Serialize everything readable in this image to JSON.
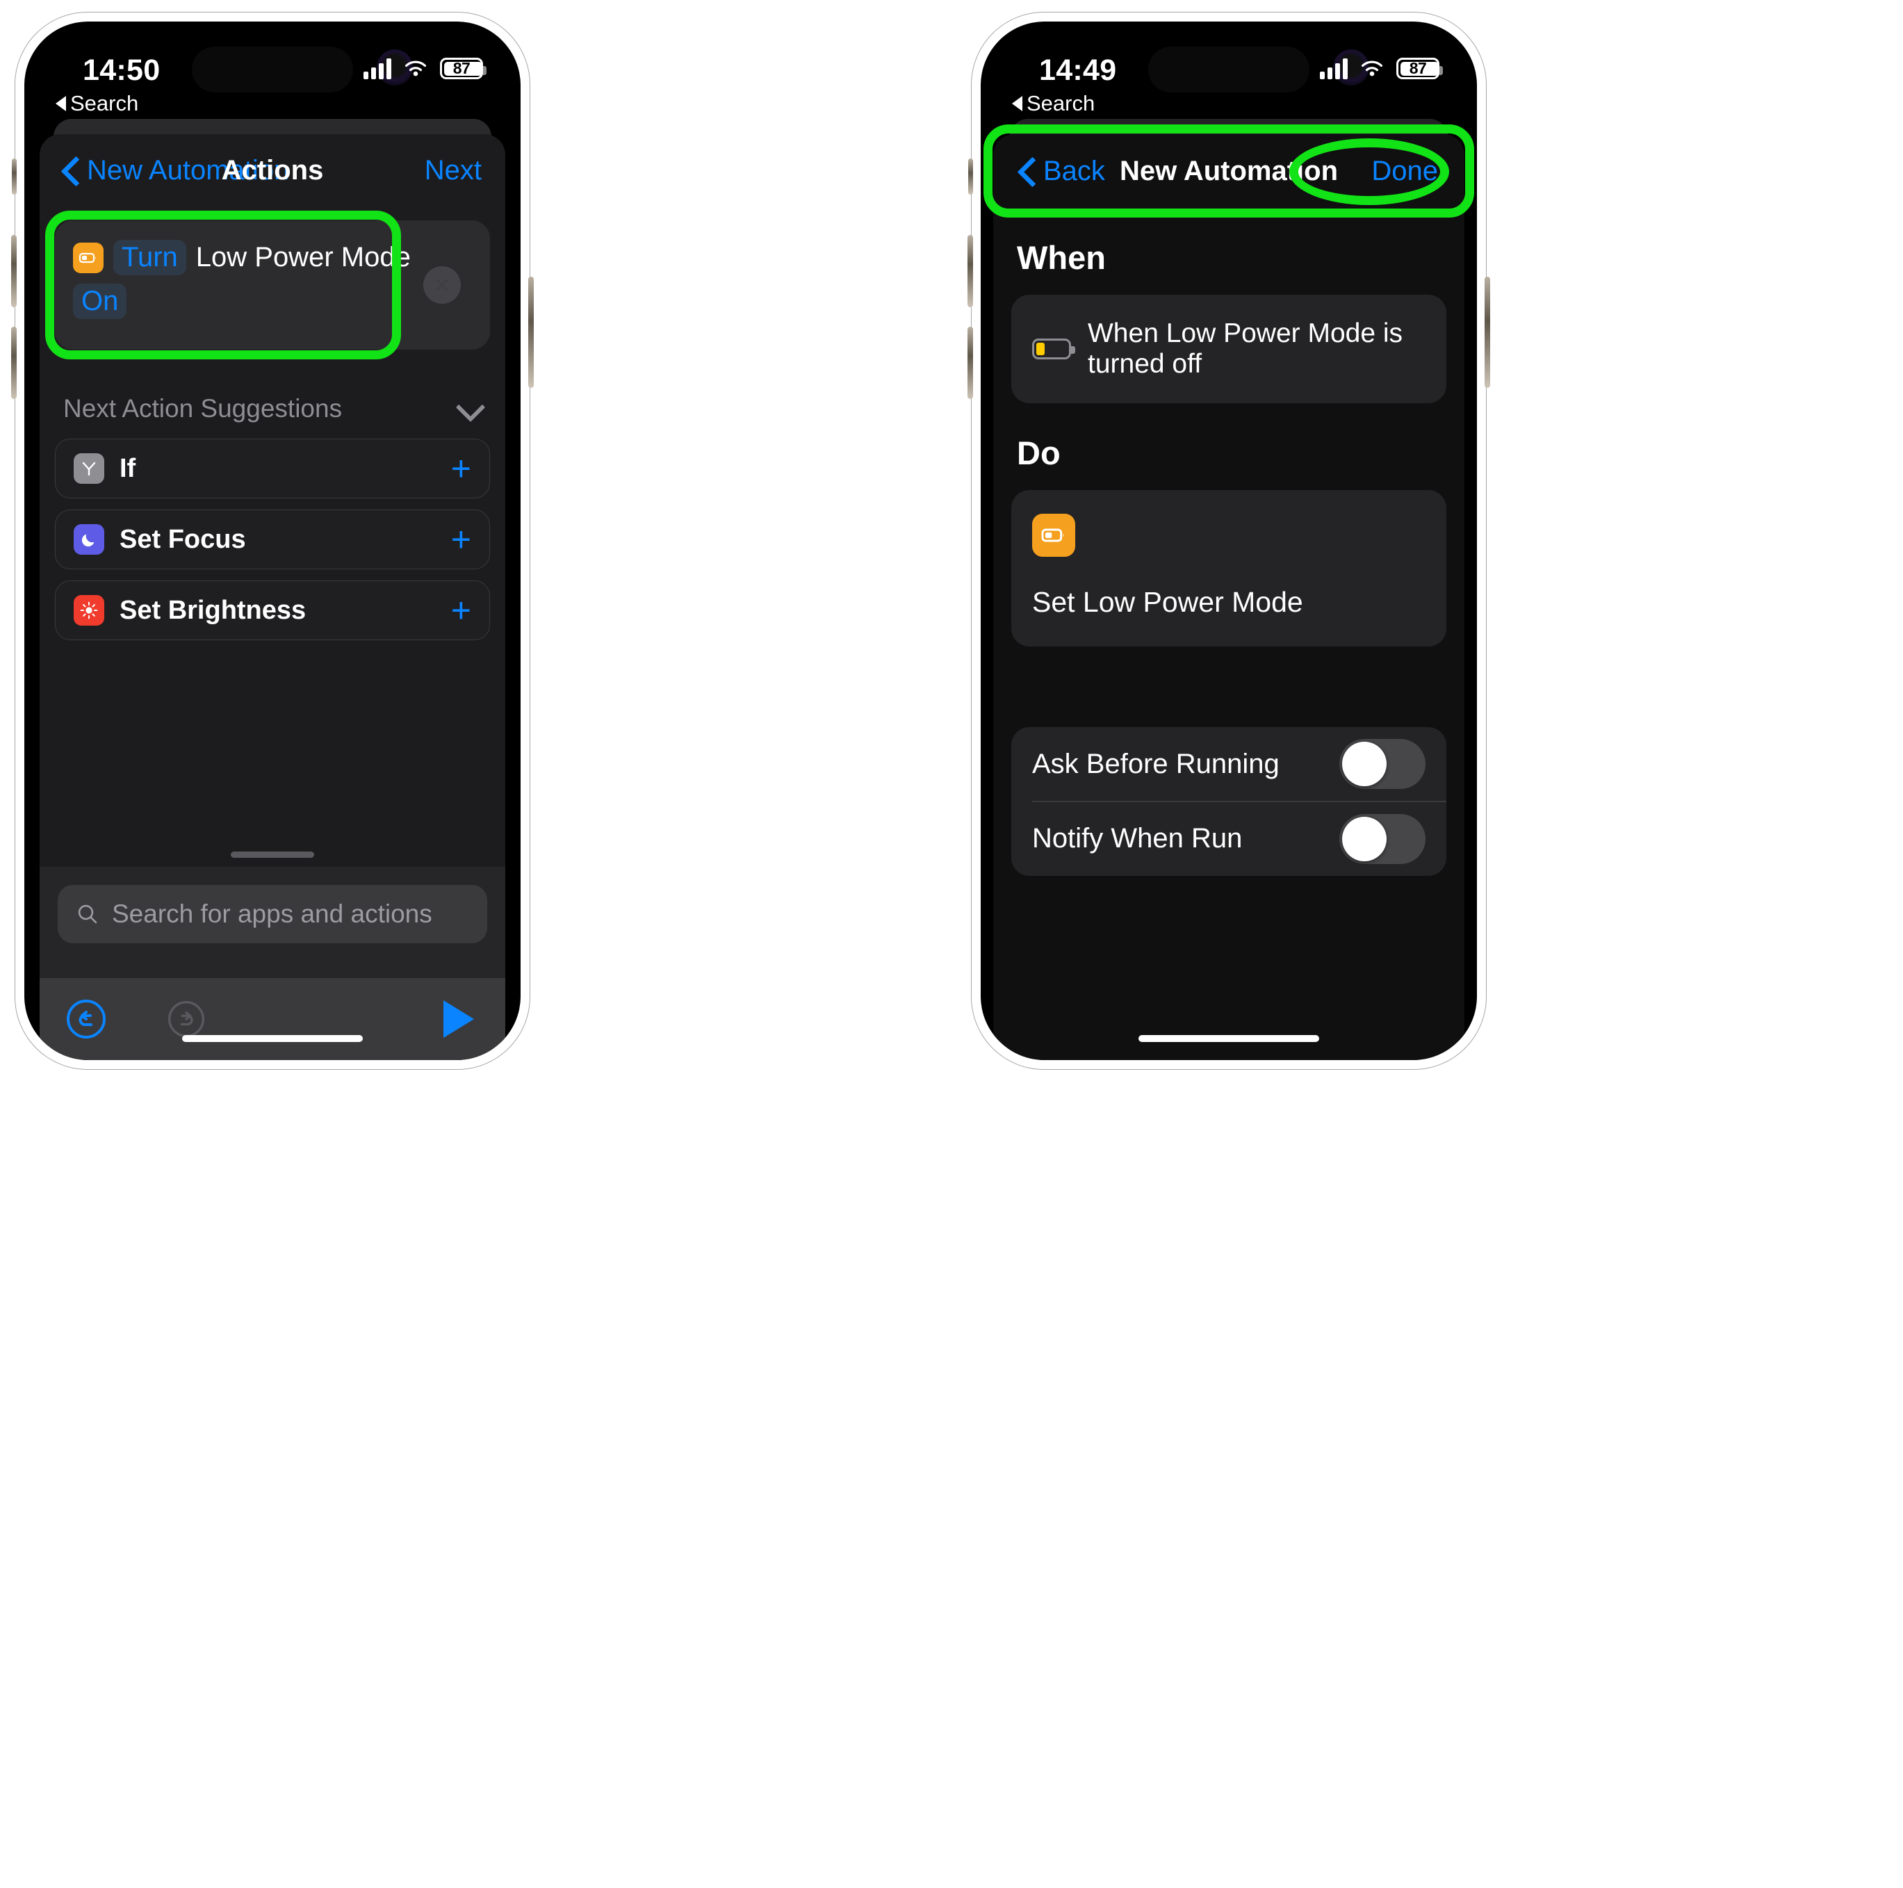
{
  "left_phone": {
    "status_bar": {
      "time": "14:50",
      "back_label": "Search",
      "battery_percent": "87",
      "icons": [
        "cellular-signal-icon",
        "wifi-icon",
        "battery-icon"
      ]
    },
    "navbar": {
      "back_label": "New Automation",
      "title": "Actions",
      "next_label": "Next"
    },
    "action_card": {
      "app_icon": "low-power-mode-icon",
      "token_verb": "Turn",
      "subject": "Low Power Mode",
      "token_state": "On",
      "close_icon": "close-icon"
    },
    "suggestions": {
      "header": "Next Action Suggestions",
      "collapse_icon": "chevron-down-icon",
      "items": [
        {
          "label": "If",
          "icon": "if-branch-icon",
          "add_icon": "plus-icon",
          "color": "#8e8e93"
        },
        {
          "label": "Set Focus",
          "icon": "moon-icon",
          "add_icon": "plus-icon",
          "color": "#5e5ce6"
        },
        {
          "label": "Set Brightness",
          "icon": "sun-icon",
          "add_icon": "plus-icon",
          "color": "#f03b2d"
        }
      ]
    },
    "search": {
      "placeholder": "Search for apps and actions",
      "icon": "search-icon"
    },
    "toolbar": {
      "undo_icon": "undo-icon",
      "redo_icon": "redo-icon",
      "run_icon": "play-icon"
    }
  },
  "right_phone": {
    "status_bar": {
      "time": "14:49",
      "back_label": "Search",
      "battery_percent": "87",
      "icons": [
        "cellular-signal-icon",
        "wifi-icon",
        "battery-icon"
      ]
    },
    "navbar": {
      "back_label": "Back",
      "title": "New Automation",
      "done_label": "Done"
    },
    "when": {
      "heading": "When",
      "trigger_label": "When Low Power Mode is turned off",
      "trigger_icon": "battery-low-icon"
    },
    "do": {
      "heading": "Do",
      "action_icon": "low-power-mode-icon",
      "action_label": "Set Low Power Mode"
    },
    "options": [
      {
        "label": "Ask Before Running",
        "state": "off"
      },
      {
        "label": "Notify When Run",
        "state": "off"
      }
    ]
  },
  "highlights": {
    "color": "#12e316",
    "targets": [
      "action-card",
      "done-button",
      "ask-before-running-row"
    ]
  }
}
